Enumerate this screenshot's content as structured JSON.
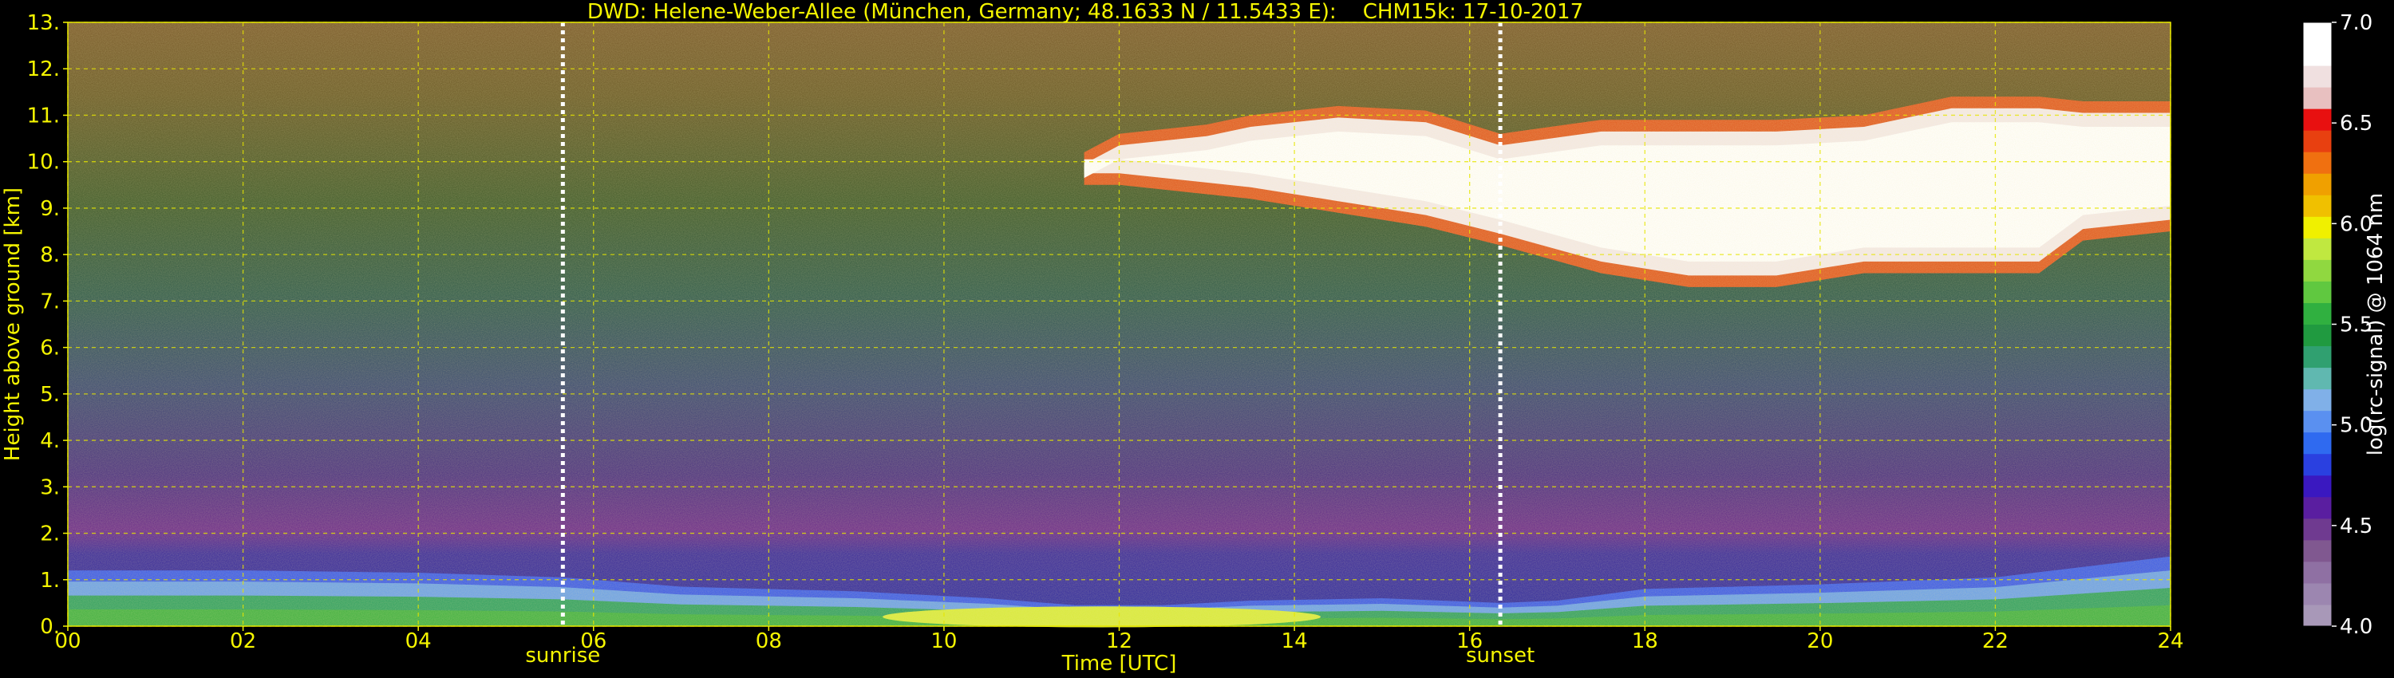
{
  "title": "DWD: Helene-Weber-Allee (München, Germany; 48.1633 N / 11.5433 E):    CHM15k: 17-10-2017",
  "colors": {
    "text": "#f5f500",
    "grid": "#e6e600",
    "background": "#000000",
    "marker": "#ffffff",
    "colorbar_label": "#ffffff"
  },
  "chart_data": {
    "type": "heatmap",
    "title": "DWD: Helene-Weber-Allee (München, Germany; 48.1633 N / 11.5433 E):    CHM15k: 17-10-2017",
    "xlabel": "Time [UTC]",
    "ylabel": "Height above ground [km]",
    "xlim": [
      0,
      24
    ],
    "ylim": [
      0,
      13
    ],
    "xticks": [
      0,
      2,
      4,
      6,
      8,
      10,
      12,
      14,
      16,
      18,
      20,
      22,
      24
    ],
    "xtick_labels": [
      "00",
      "02",
      "04",
      "06",
      "08",
      "10",
      "12",
      "14",
      "16",
      "18",
      "20",
      "22",
      "24"
    ],
    "yticks": [
      0,
      1,
      2,
      3,
      4,
      5,
      6,
      7,
      8,
      9,
      10,
      11,
      12,
      13
    ],
    "ytick_labels": [
      "0.",
      "1.",
      "2.",
      "3.",
      "4.",
      "5.",
      "6.",
      "7.",
      "8.",
      "9.",
      "10.",
      "11.",
      "12.",
      "13."
    ],
    "grid": true,
    "markers": [
      {
        "label": "sunrise",
        "time": 5.65
      },
      {
        "label": "sunset",
        "time": 16.35
      }
    ],
    "colorbar": {
      "label": "log(rc-signal) @ 1064 nm",
      "range": [
        4.0,
        7.0
      ],
      "ticks": [
        4.0,
        4.5,
        5.0,
        5.5,
        6.0,
        6.5,
        7.0
      ],
      "tick_labels": [
        "4.0",
        "4.5",
        "5.0",
        "5.5",
        "6.0",
        "6.5",
        "7.0"
      ],
      "colors": [
        "#a898b8",
        "#9c86b0",
        "#8f70a3",
        "#805890",
        "#6f3a90",
        "#5a1ea0",
        "#3a18c0",
        "#2a40e0",
        "#2f6af0",
        "#5a90f0",
        "#80b0e8",
        "#60b8b0",
        "#30a070",
        "#209a40",
        "#30b040",
        "#60c840",
        "#90d840",
        "#c0e840",
        "#f0f000",
        "#f0c000",
        "#f0a000",
        "#f07010",
        "#e84010",
        "#e81010",
        "#e8c0c0",
        "#f0e0e0",
        "#ffffff",
        "#ffffff"
      ]
    },
    "boundary_layer": {
      "time": [
        0,
        2,
        4,
        5.65,
        7,
        9,
        10.5,
        11.5,
        12.5,
        13.5,
        15,
        16.35,
        17,
        18,
        20,
        22,
        24
      ],
      "top_km": [
        1.2,
        1.2,
        1.15,
        1.05,
        0.85,
        0.75,
        0.6,
        0.45,
        0.45,
        0.55,
        0.6,
        0.5,
        0.55,
        0.8,
        0.9,
        1.05,
        1.5
      ]
    },
    "cirrus_cloud": {
      "time": [
        11.6,
        12.0,
        13.0,
        13.5,
        14.5,
        15.5,
        16.35,
        17.5,
        18.5,
        19.5,
        20.5,
        21.5,
        22.5,
        23.0,
        24.0
      ],
      "base_km": [
        9.5,
        9.5,
        9.3,
        9.2,
        8.9,
        8.6,
        8.2,
        7.6,
        7.3,
        7.3,
        7.6,
        7.6,
        7.6,
        8.3,
        8.5
      ],
      "top_km": [
        10.2,
        10.6,
        10.8,
        11.0,
        11.2,
        11.1,
        10.6,
        10.9,
        10.9,
        10.9,
        11.0,
        11.4,
        11.4,
        11.3,
        11.3
      ]
    }
  }
}
